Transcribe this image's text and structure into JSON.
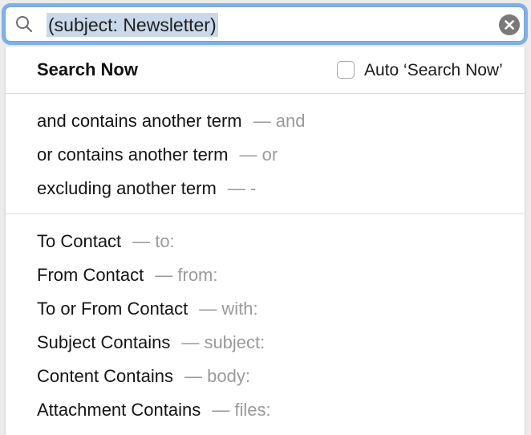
{
  "search": {
    "query": "(subject: Newsletter)"
  },
  "menu": {
    "search_now_label": "Search Now",
    "auto_search_label": "Auto ‘Search Now’",
    "auto_search_checked": false,
    "operators": [
      {
        "label": "and contains another term",
        "hint": "— and"
      },
      {
        "label": "or contains another term",
        "hint": "— or"
      },
      {
        "label": "excluding another term",
        "hint": "— -"
      }
    ],
    "fields": [
      {
        "label": "To Contact",
        "hint": "— to:"
      },
      {
        "label": "From Contact",
        "hint": "— from:"
      },
      {
        "label": "To or From Contact",
        "hint": "— with:"
      },
      {
        "label": "Subject Contains",
        "hint": "— subject:"
      },
      {
        "label": "Content Contains",
        "hint": "— body:"
      },
      {
        "label": "Attachment Contains",
        "hint": "— files:"
      }
    ]
  },
  "colors": {
    "focus_ring": "#7fb0ea",
    "selection": "#c9d9ea",
    "hint_text": "#9a9a9a"
  },
  "icons": {
    "search": "search-icon",
    "clear": "clear-icon"
  }
}
